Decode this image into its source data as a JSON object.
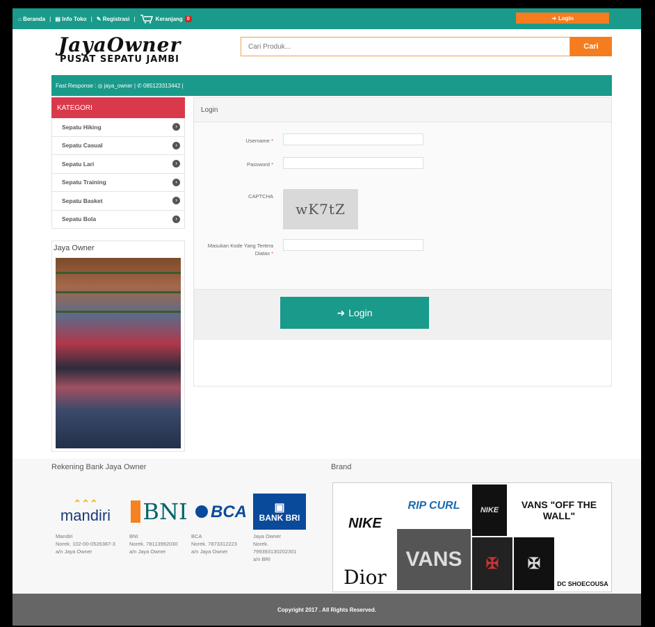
{
  "topbar": {
    "nav": [
      {
        "icon": "home-icon",
        "glyph": "⌂",
        "label": "Beranda"
      },
      {
        "icon": "store-icon",
        "glyph": "▤",
        "label": "Info Toko"
      },
      {
        "icon": "edit-icon",
        "glyph": "✎",
        "label": "Registrasi"
      },
      {
        "icon": "cart-icon",
        "glyph": "🛒",
        "label": "Keranjang"
      }
    ],
    "cart_count": "0",
    "login_label": "Login",
    "login_glyph": "➜"
  },
  "logo": {
    "main": "JayaOwner",
    "sub": "PUSAT SEPATU JAMBI"
  },
  "search": {
    "placeholder": "Cari Produk...",
    "button": "Cari"
  },
  "infobar": {
    "text": "Fast Response : ◎ jaya_owner | ✆ 085123313442 |"
  },
  "sidebar": {
    "category_title": "KATEGORI",
    "categories": [
      "Sepatu Hiking",
      "Sepatu Casual",
      "Sepatu Lari",
      "Sepatu Training",
      "Sepatu Basket",
      "Sepatu Bola"
    ],
    "store_title": "Jaya Owner"
  },
  "login_panel": {
    "title": "Login",
    "username_label": "Username",
    "password_label": "Password",
    "captcha_label": "CAPTCHA",
    "captcha_text": "wK7tZ",
    "code_label_1": "Masukan Kode Yang Tertera",
    "code_label_2": "Diatas",
    "required_mark": "*",
    "button": "Login",
    "button_glyph": "➜"
  },
  "footer": {
    "bank_title": "Rekening Bank Jaya Owner",
    "brand_title": "Brand",
    "banks": [
      {
        "logo": "mandiri",
        "name": "Mandiri",
        "account": "Norek. 102-00-0526387-3",
        "holder": "a/n Jaya Owner"
      },
      {
        "logo": "BNI",
        "name": "BNI",
        "account": "Norek. 78113992030",
        "holder": "a/n Jaya Owner"
      },
      {
        "logo": "BCA",
        "name": "BCA",
        "account": "Norek. 7873312223",
        "holder": "a/n Jaya Owner"
      },
      {
        "logo": "BANK BRI",
        "name": "Jaya Owner",
        "account": "Norek. 799393130202301",
        "holder": "a/n BRI"
      }
    ],
    "brands": [
      "NIKE",
      "RIP CURL",
      "NIKE",
      "VANS \"OFF THE WALL\"",
      "VANS",
      "Dior",
      "DC SHOECOUSA"
    ]
  },
  "copyright": "Copyright 2017 . All Rights Reserved.",
  "colors": {
    "teal": "#1a9a8a",
    "orange": "#f57c1f",
    "red": "#d93a4b"
  }
}
